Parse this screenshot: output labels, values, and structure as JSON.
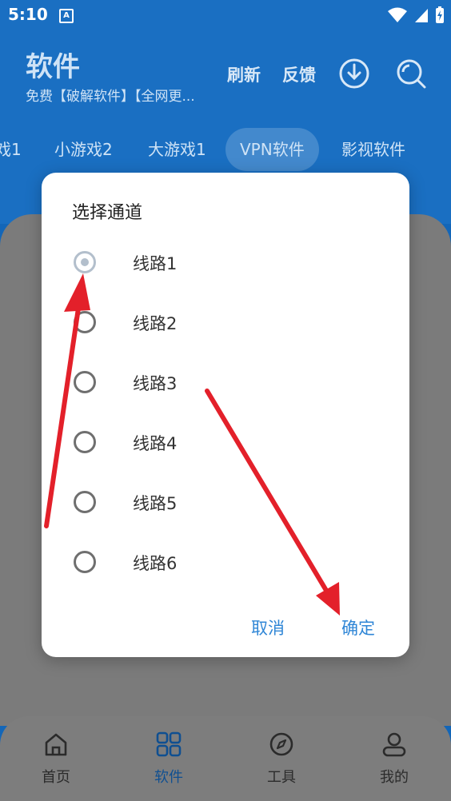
{
  "status_bar": {
    "time": "5:10",
    "notif_letter": "A"
  },
  "header": {
    "title": "软件",
    "subtitle": "免费【破解软件】【全网更...",
    "refresh_label": "刷新",
    "feedback_label": "反馈"
  },
  "tabs": [
    {
      "label": "戏1"
    },
    {
      "label": "小游戏2"
    },
    {
      "label": "大游戏1"
    },
    {
      "label": "VPN软件",
      "active": true
    },
    {
      "label": "影视软件"
    }
  ],
  "dialog": {
    "title": "选择通道",
    "options": [
      {
        "label": "线路1",
        "selected": true
      },
      {
        "label": "线路2",
        "selected": false
      },
      {
        "label": "线路3",
        "selected": false
      },
      {
        "label": "线路4",
        "selected": false
      },
      {
        "label": "线路5",
        "selected": false
      },
      {
        "label": "线路6",
        "selected": false
      }
    ],
    "cancel_label": "取消",
    "confirm_label": "确定"
  },
  "bottom_nav": [
    {
      "label": "首页",
      "icon": "home-icon"
    },
    {
      "label": "软件",
      "icon": "grid-icon",
      "active": true
    },
    {
      "label": "工具",
      "icon": "compass-icon"
    },
    {
      "label": "我的",
      "icon": "user-icon"
    }
  ],
  "colors": {
    "header": "#1a6fc2",
    "accent": "#2f86d6",
    "annotation_arrow": "#e3202a"
  }
}
